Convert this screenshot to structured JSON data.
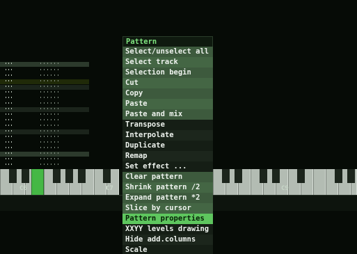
{
  "menu": {
    "title": "Pattern",
    "items": [
      "Select/unselect all",
      "Select track",
      "Selection begin",
      "Cut",
      "Copy",
      "Paste",
      "Paste and mix",
      "Transpose",
      "Interpolate",
      "Duplicate",
      "Remap",
      "Set effect ...",
      "Clear pattern",
      "Shrink pattern /2",
      "Expand pattern *2",
      "Slice by cursor",
      "Pattern properties",
      "XXYY levels drawing",
      "Hide add.columns",
      "Scale"
    ],
    "selected_index": 16
  },
  "piano": {
    "labels": [
      "C6",
      "C7",
      "C9"
    ],
    "pressed_key": "D6"
  },
  "colors": {
    "background": "#060b06",
    "menu_group_a": "#3d5a3d",
    "menu_group_b": "#151e15",
    "selection": "#5ec65e",
    "title_text": "#7fe37f"
  }
}
